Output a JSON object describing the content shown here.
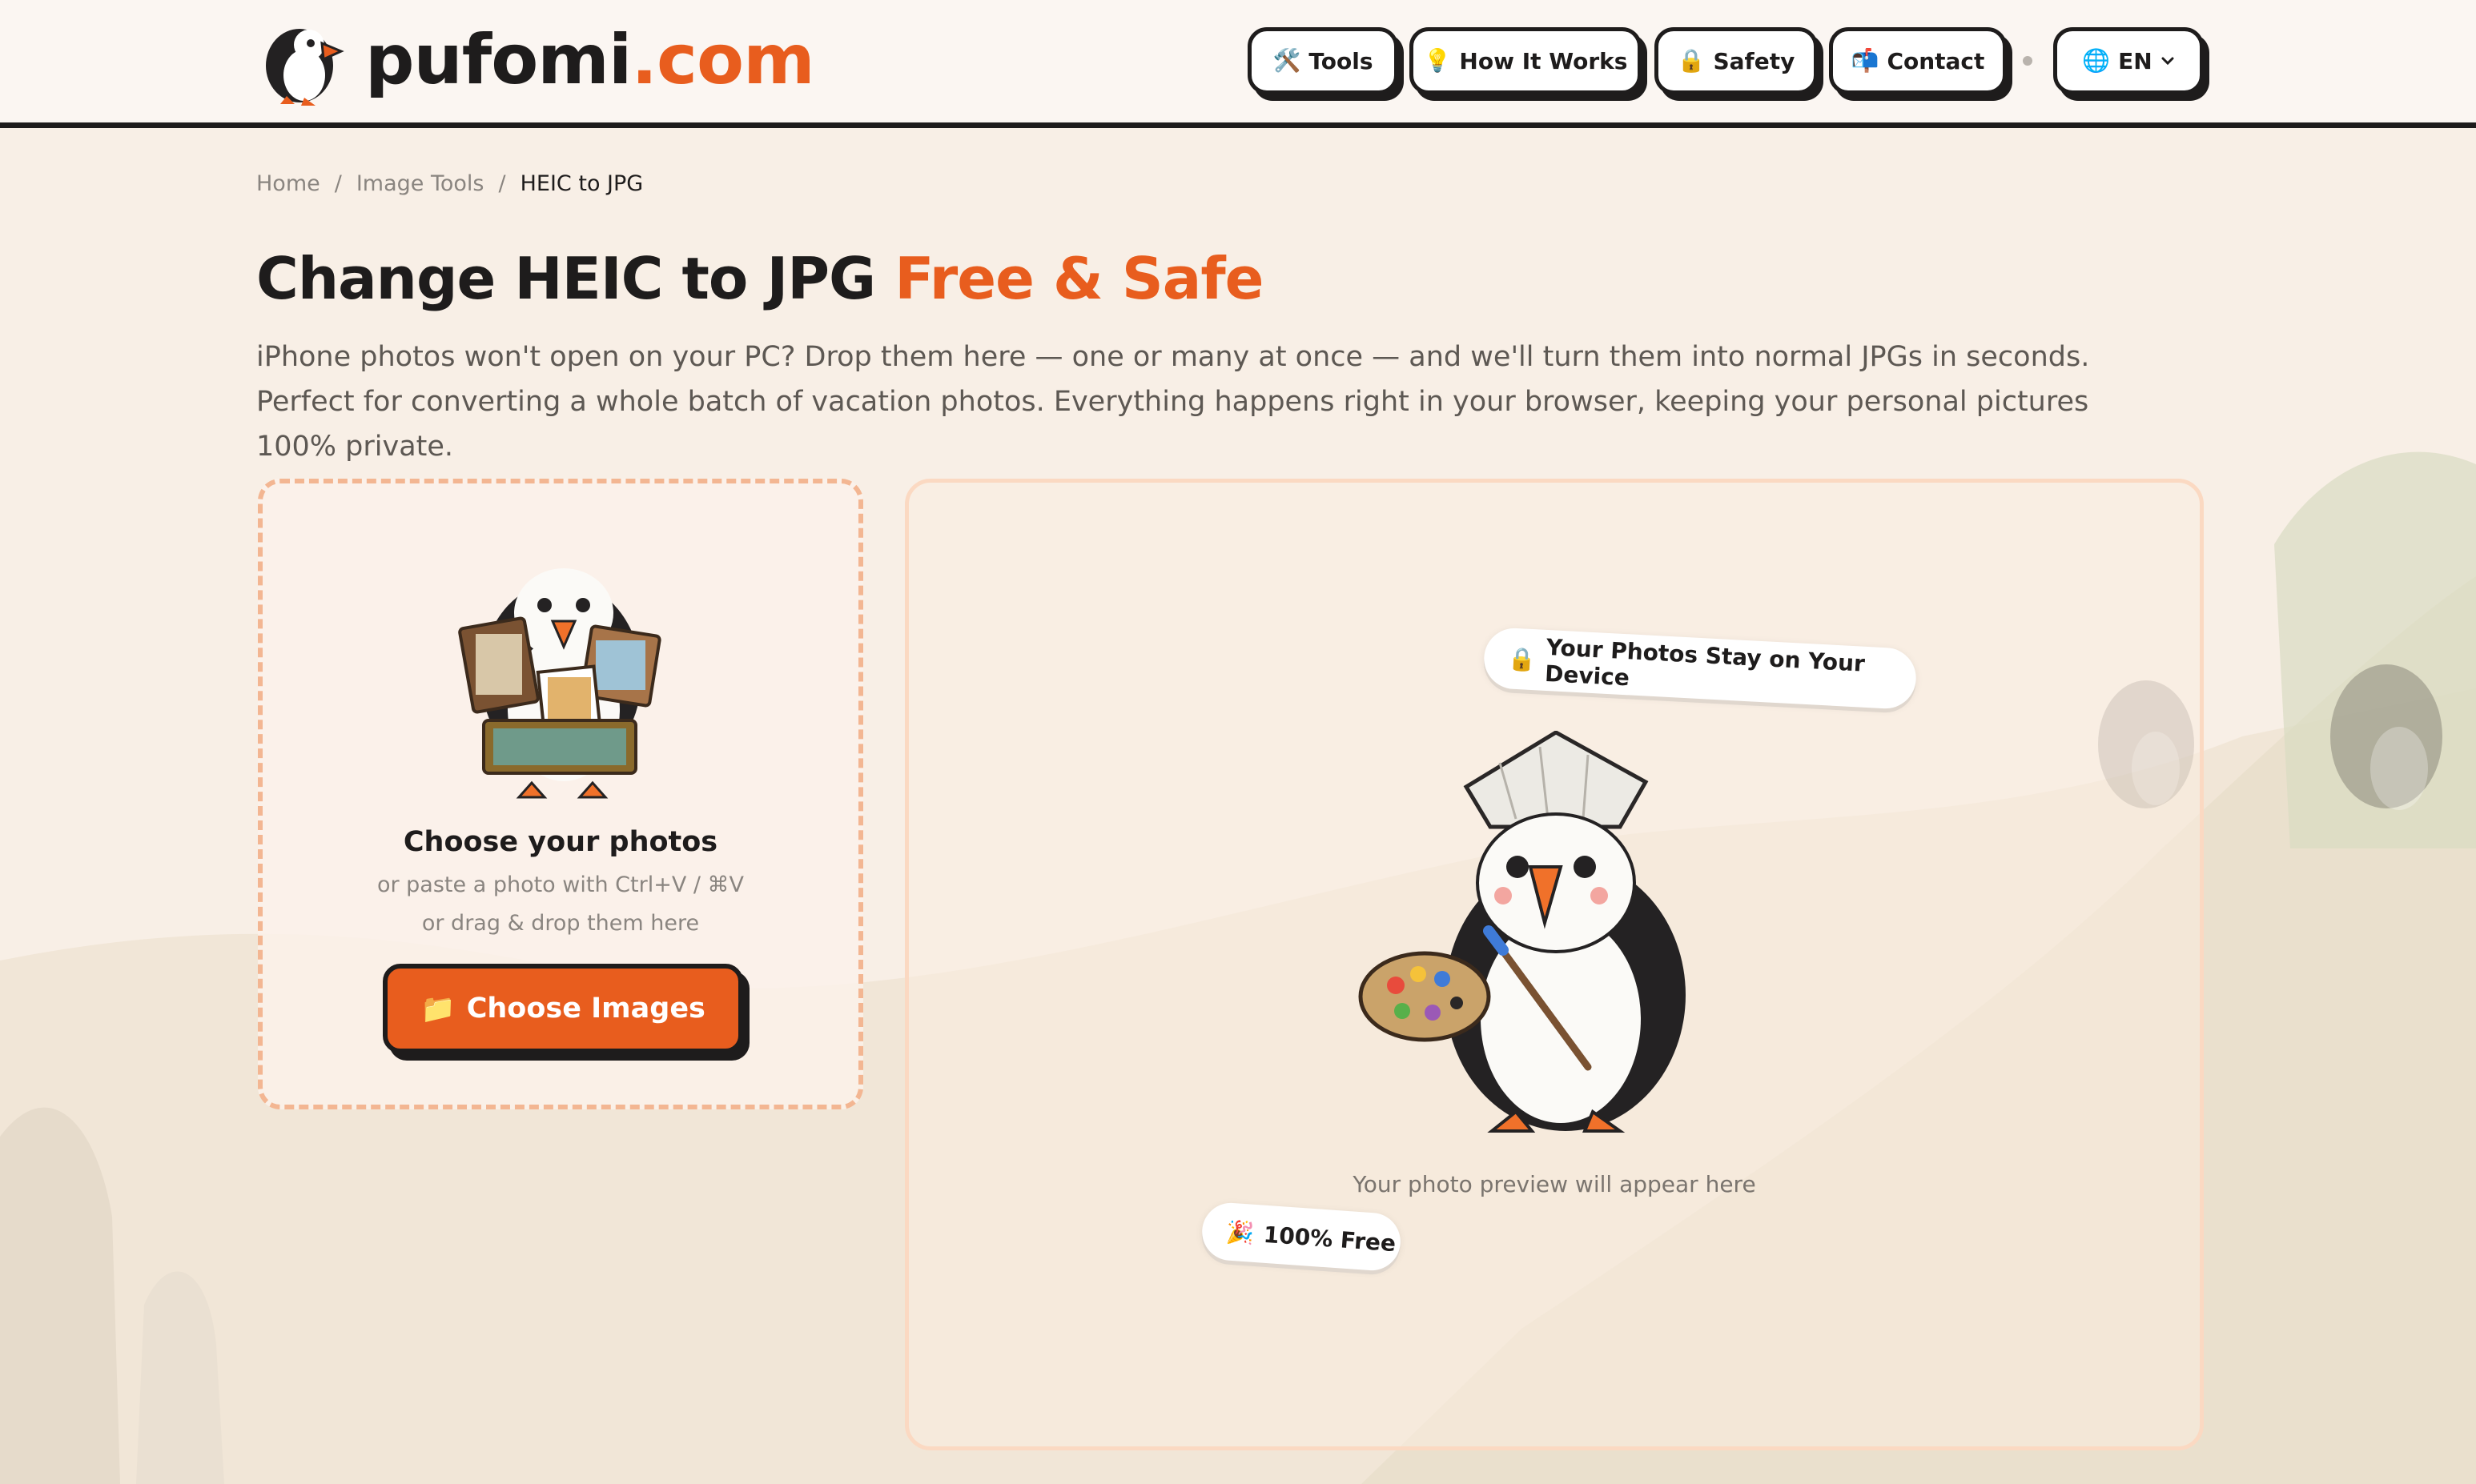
{
  "brand": {
    "name": "pufomi",
    "domain": ".com",
    "accent": "#e85d1e",
    "ink": "#1e1c1c"
  },
  "nav": {
    "tools": {
      "icon": "🛠️",
      "label": "Tools"
    },
    "how": {
      "icon": "💡",
      "label": "How It Works"
    },
    "safety": {
      "icon": "🔒",
      "label": "Safety"
    },
    "contact": {
      "icon": "📬",
      "label": "Contact"
    },
    "language": {
      "icon": "🌐",
      "label": "EN"
    }
  },
  "breadcrumb": {
    "home": "Home",
    "sep": "/",
    "section": "Image Tools",
    "current": "HEIC to JPG"
  },
  "hero": {
    "title_main": "Change HEIC to JPG",
    "title_accent": "Free & Safe",
    "description": "iPhone photos won't open on your PC? Drop them here — one or many at once — and we'll turn them into normal JPGs in seconds. Perfect for converting a whole batch of vacation photos. Everything happens right in your browser, keeping your personal pictures 100% private."
  },
  "upload": {
    "title": "Choose your photos",
    "paste_hint": "or paste a photo with Ctrl+V / ⌘V",
    "drag_hint": "or drag & drop them here",
    "button_icon": "📁",
    "button_label": "Choose Images"
  },
  "preview": {
    "privacy_badge_icon": "🔒",
    "privacy_badge": "Your Photos Stay on Your Device",
    "free_badge_icon": "🎉",
    "free_badge": "100% Free",
    "placeholder": "Your photo preview will appear here"
  }
}
